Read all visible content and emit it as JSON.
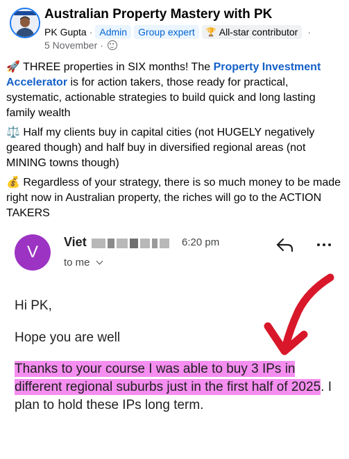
{
  "post": {
    "group_name": "Australian Property Mastery with PK",
    "author": "PK Gupta",
    "badges": [
      "Admin",
      "Group expert"
    ],
    "contributor_badge": "All-star contributor",
    "contributor_icon": "trophy-icon",
    "date": "5 November",
    "privacy_icon": "group-privacy-icon",
    "paragraphs": {
      "p1_prefix": "🚀 THREE properties in SIX months! The ",
      "p1_link": "Property Investment Accelerator",
      "p1_suffix": " is for action takers, those ready for practical, systematic, actionable strategies to build quick and long lasting family wealth",
      "p2": "⚖️ Half my clients buy in capital cities (not HUGELY negatively geared though) and half buy in diversified regional areas (not MINING towns though)",
      "p3": "💰 Regardless of your strategy, there is so much money to be made right now in Australian property, the riches will go to the ACTION TAKERS"
    }
  },
  "email": {
    "sender_initial": "V",
    "sender_name": "Viet",
    "time": "6:20 pm",
    "recipient": "to me",
    "greeting": "Hi PK,",
    "line2": "Hope you are well",
    "highlighted": "Thanks to your course I was able to buy 3 IPs in different regional suburbs just in the first half of 2025",
    "rest": ". I plan to hold these IPs long term."
  },
  "colors": {
    "avatar_purple": "#9c33c3",
    "link_blue": "#1460c8",
    "highlight_pink": "#f58ef0",
    "arrow_red": "#d8182a"
  }
}
